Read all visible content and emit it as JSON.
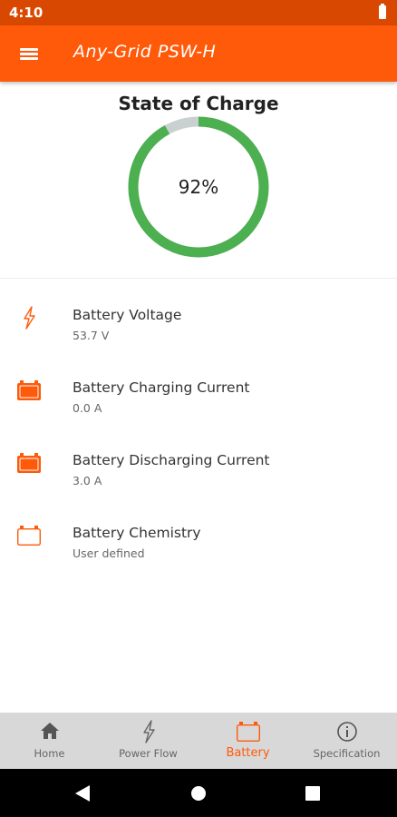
{
  "status_bar": {
    "time": "4:10"
  },
  "app_bar": {
    "title": "Any-Grid PSW-H"
  },
  "soc": {
    "title": "State of Charge",
    "percent_label": "92%",
    "fraction": 0.92,
    "fill_color": "#4caf50",
    "track_color": "#c8d0d0"
  },
  "battery_info": [
    {
      "label": "Battery Voltage",
      "value": "53.7 V",
      "icon": "lightning-icon"
    },
    {
      "label": "Battery Charging Current",
      "value": "0.0 A",
      "icon": "battery-icon"
    },
    {
      "label": "Battery Discharging Current",
      "value": "3.0 A",
      "icon": "battery-icon"
    },
    {
      "label": "Battery Chemistry",
      "value": "User defined",
      "icon": "battery-outline-icon"
    }
  ],
  "bottom_nav": [
    {
      "label": "Home",
      "icon": "home-icon"
    },
    {
      "label": "Power Flow",
      "icon": "lightning-icon"
    },
    {
      "label": "Battery",
      "icon": "battery-outline-icon",
      "active": true
    },
    {
      "label": "Specification",
      "icon": "info-icon"
    }
  ],
  "colors": {
    "accent": "#ff5a0a",
    "status_bar": "#d94800",
    "gauge": "#4caf50"
  }
}
